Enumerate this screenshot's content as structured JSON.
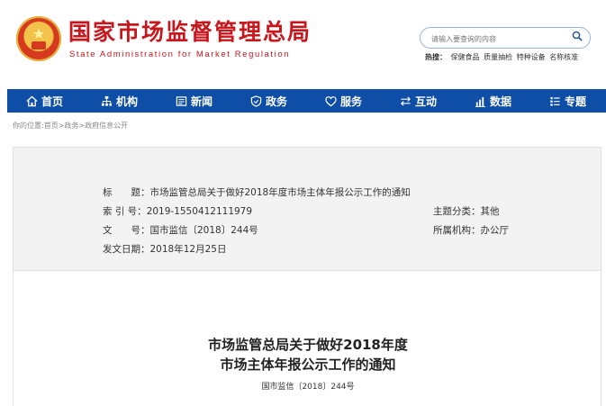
{
  "site": {
    "title": "国家市场监督管理总局",
    "subtitle": "State Administration for Market Regulation"
  },
  "search": {
    "placeholder": "请输入要查询的内容"
  },
  "hot": {
    "label": "热搜：",
    "links": [
      "保健食品",
      "质量抽检",
      "特种设备",
      "名称核准"
    ]
  },
  "nav": [
    {
      "label": "首页",
      "icon": "home-icon"
    },
    {
      "label": "机构",
      "icon": "org-chart-icon"
    },
    {
      "label": "新闻",
      "icon": "news-icon"
    },
    {
      "label": "政务",
      "icon": "shield-icon"
    },
    {
      "label": "服务",
      "icon": "heart-icon"
    },
    {
      "label": "互动",
      "icon": "exchange-icon"
    },
    {
      "label": "数据",
      "icon": "bar-chart-icon"
    },
    {
      "label": "专题",
      "icon": "list-icon"
    }
  ],
  "breadcrumb": "你的位置:首页>政务>政府信息公开",
  "info": {
    "title_label": "标　　题：",
    "title_value": "市场监管总局关于做好2018年度市场主体年报公示工作的通知",
    "index_label": "索 引 号：",
    "index_value": "2019-1550412111979",
    "category_label": "主题分类：",
    "category_value": "其他",
    "docno_label": "文　　号：",
    "docno_value": "国市监信〔2018〕244号",
    "org_label": "所属机构：",
    "org_value": "办公厅",
    "date_label": "发文日期：",
    "date_value": "2018年12月25日"
  },
  "document": {
    "title_line1": "市场监管总局关于做好2018年度",
    "title_line2": "市场主体年报公示工作的通知",
    "number": "国市监信〔2018〕244号"
  },
  "colors": {
    "brand_red": "#c8161d",
    "nav_blue": "#0e4ea7"
  }
}
